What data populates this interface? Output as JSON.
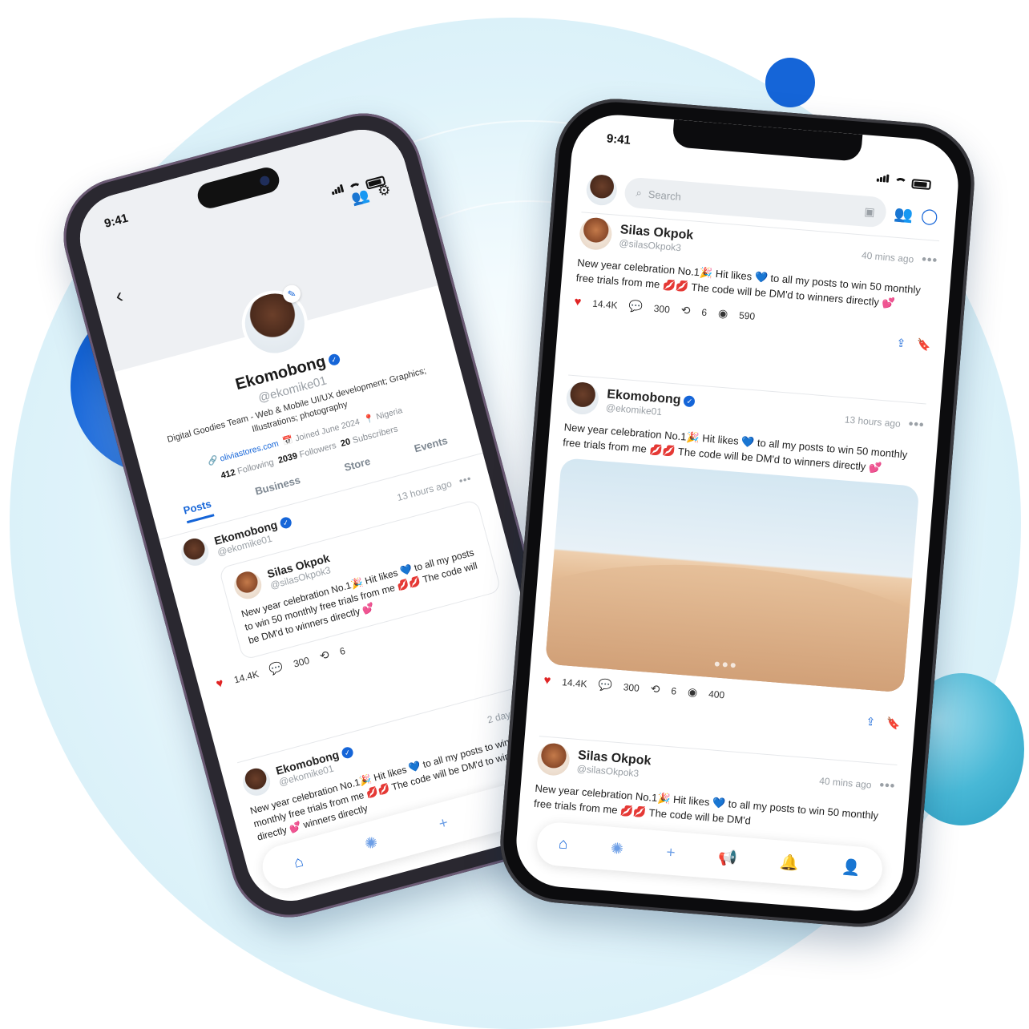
{
  "colors": {
    "accent": "#1565d8",
    "heart": "#e02424"
  },
  "left_phone": {
    "status_time": "9:41",
    "profile": {
      "name": "Ekomobong",
      "handle": "@ekomike01",
      "bio": "Digital Goodies Team - Web & Mobile UI/UX development; Graphics; Illustrations; photography",
      "link": "oliviastores.com",
      "joined": "Joined June 2024",
      "location": "Nigeria",
      "following_count": "412",
      "following_label": "Following",
      "followers_count": "2039",
      "followers_label": "Followers",
      "subscribers_count": "20",
      "subscribers_label": "Subscribers"
    },
    "tabs": [
      "Posts",
      "Business",
      "Store",
      "Events"
    ],
    "post1": {
      "name": "Ekomobong",
      "handle": "@ekomike01",
      "time": "13 hours ago",
      "quote": {
        "name": "Silas Okpok",
        "handle": "@silasOkpok3",
        "text": "New year celebration No.1🎉 Hit likes 💙 to all my posts to win 50 monthly free trials from me 💋💋 The code will be DM'd to winners directly 💕"
      },
      "likes": "14.4K",
      "comments": "300",
      "reposts": "6"
    },
    "post2": {
      "name": "Ekomobong",
      "handle": "@ekomike01",
      "time": "2 days ago",
      "text": "New year celebration No.1🎉 Hit likes 💙 to all my posts to win 50 monthly free trials from me 💋💋 The code will be DM'd to winners directly 💕 winners directly"
    }
  },
  "right_phone": {
    "status_time": "9:41",
    "search_placeholder": "Search",
    "post1": {
      "name": "Silas Okpok",
      "handle": "@silasOkpok3",
      "time": "40 mins ago",
      "text": "New year celebration No.1🎉 Hit likes 💙 to all my posts to win 50 monthly free trials from me 💋💋 The code will be DM'd to winners directly 💕",
      "likes": "14.4K",
      "comments": "300",
      "reposts": "6",
      "views": "590"
    },
    "post2": {
      "name": "Ekomobong",
      "handle": "@ekomike01",
      "time": "13 hours ago",
      "text": "New year celebration No.1🎉 Hit likes 💙 to all my posts to win 50 monthly free trials from me 💋💋 The code will be DM'd to winners directly 💕",
      "likes": "14.4K",
      "comments": "300",
      "reposts": "6",
      "views": "400"
    },
    "post3": {
      "name": "Silas Okpok",
      "handle": "@silasOkpok3",
      "time": "40 mins ago",
      "text": "New year celebration No.1🎉 Hit likes 💙 to all my posts to win 50 monthly free trials from me 💋💋 The code will be DM'd"
    }
  },
  "icons": {
    "home": "⌂",
    "explore": "✺",
    "add": "+",
    "megaphone": "📢",
    "bell": "🔔",
    "profile": "👤",
    "back": "‹",
    "add_user": "👥",
    "settings": "⚙",
    "search": "⌕",
    "share": "⇪",
    "bookmark": "🔖",
    "comment": "💬",
    "repost": "⟲",
    "view": "◉",
    "link": "🔗",
    "calendar": "📅",
    "pin": "📍",
    "chat": "◯",
    "filter": "▣"
  }
}
